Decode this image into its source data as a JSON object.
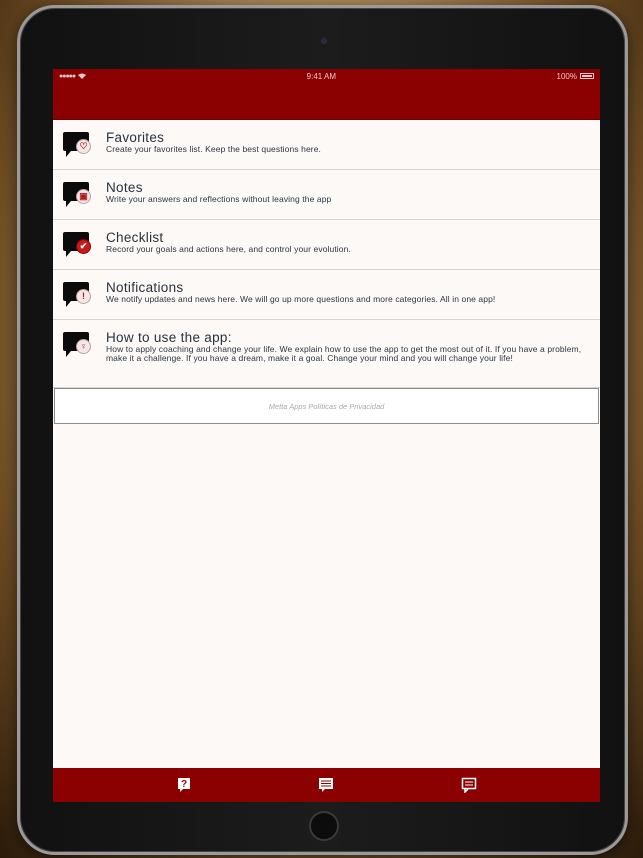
{
  "status_bar": {
    "signal": "●●●●●",
    "time": "9:41 AM",
    "battery": "100%"
  },
  "menu": {
    "items": [
      {
        "title": "Favorites",
        "description": "Create your favorites list. Keep the best questions here.",
        "icon": "heart-icon"
      },
      {
        "title": "Notes",
        "description": "Write your answers and reflections without leaving the app",
        "icon": "note-icon"
      },
      {
        "title": "Checklist",
        "description": "Record your goals and actions here, and control your evolution.",
        "icon": "checkmark-icon"
      },
      {
        "title": "Notifications",
        "description": "We notify updates and news here. We will go up more questions and more categories. All in one app!",
        "icon": "exclamation-icon"
      },
      {
        "title": "How to use the app:",
        "description": "How to apply coaching and change your life. We explain how to use the app to get the most out of it. If you have a problem, make it a challenge. If you have a dream, make it a goal. Change your mind and you will change your life!",
        "icon": "lightbulb-icon"
      }
    ]
  },
  "privacy": {
    "label": "Metta Apps Políticas de Privacidad"
  },
  "tab_bar": {
    "icons": [
      "question-icon",
      "chat-lines-icon",
      "chat-icon"
    ]
  },
  "colors": {
    "brand": "#8b0000",
    "background": "#fdf9f7",
    "title_text": "#27323e",
    "accent_red": "#c41a1a"
  }
}
